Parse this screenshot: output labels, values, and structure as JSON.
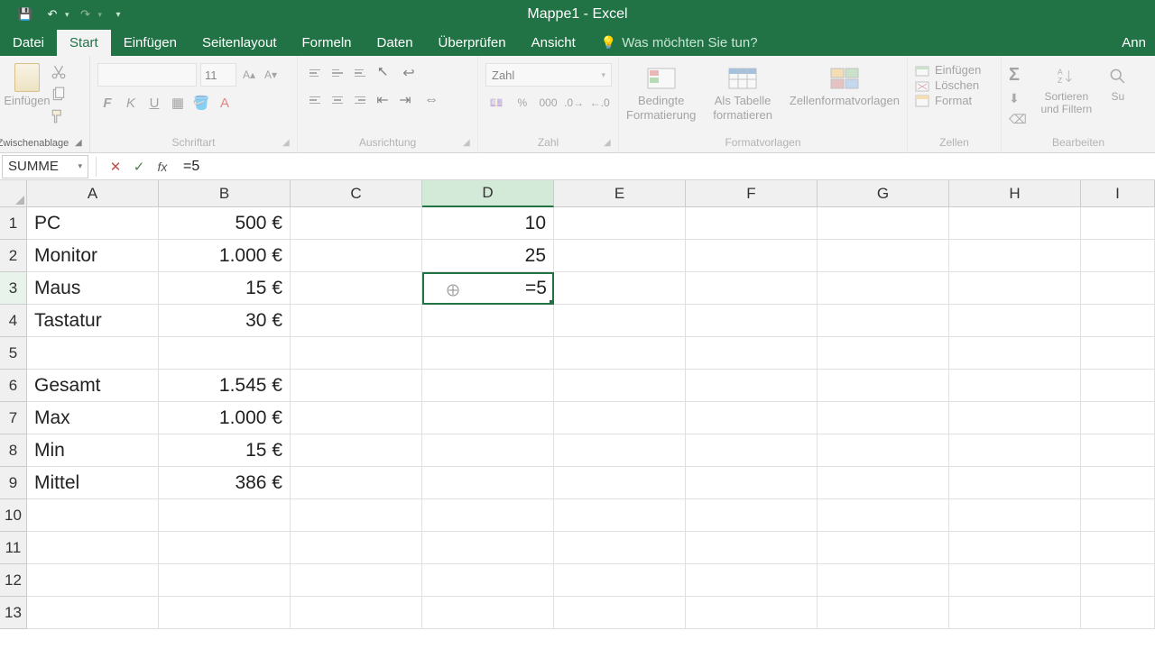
{
  "title": "Mappe1 - Excel",
  "tabs": {
    "datei": "Datei",
    "start": "Start",
    "einfuegen": "Einfügen",
    "seitenlayout": "Seitenlayout",
    "formeln": "Formeln",
    "daten": "Daten",
    "ueberpruefen": "Überprüfen",
    "ansicht": "Ansicht",
    "tellme": "Was möchten Sie tun?",
    "right": "Ann"
  },
  "ribbon": {
    "clipboard": {
      "label": "Zwischenablage",
      "paste": "Einfügen"
    },
    "font": {
      "label": "Schriftart",
      "size": "11"
    },
    "alignment": {
      "label": "Ausrichtung"
    },
    "number": {
      "label": "Zahl",
      "format": "Zahl"
    },
    "styles": {
      "label": "Formatvorlagen",
      "conditional": "Bedingte Formatierung",
      "table": "Als Tabelle formatieren",
      "cellstyles": "Zellenformatvorlagen"
    },
    "cells": {
      "label": "Zellen",
      "insert": "Einfügen",
      "delete": "Löschen",
      "format": "Format"
    },
    "edit": {
      "label": "Bearbeiten",
      "sortfilter": "Sortieren und Filtern",
      "find": "Su"
    }
  },
  "namebox": "SUMME",
  "formula": "=5",
  "columns": [
    "A",
    "B",
    "C",
    "D",
    "E",
    "F",
    "G",
    "H",
    "I"
  ],
  "rows": [
    "1",
    "2",
    "3",
    "4",
    "5",
    "6",
    "7",
    "8",
    "9",
    "10",
    "11",
    "12",
    "13"
  ],
  "data": {
    "A1": "PC",
    "B1": "500 €",
    "D1": "10",
    "A2": "Monitor",
    "B2": "1.000 €",
    "D2": "25",
    "A3": "Maus",
    "B3": "15 €",
    "D3": "=5",
    "A4": "Tastatur",
    "B4": "30 €",
    "A6": "Gesamt",
    "B6": "1.545 €",
    "A7": "Max",
    "B7": "1.000 €",
    "A8": "Min",
    "B8": "15 €",
    "A9": "Mittel",
    "B9": "386 €"
  },
  "active_cell": "D3"
}
